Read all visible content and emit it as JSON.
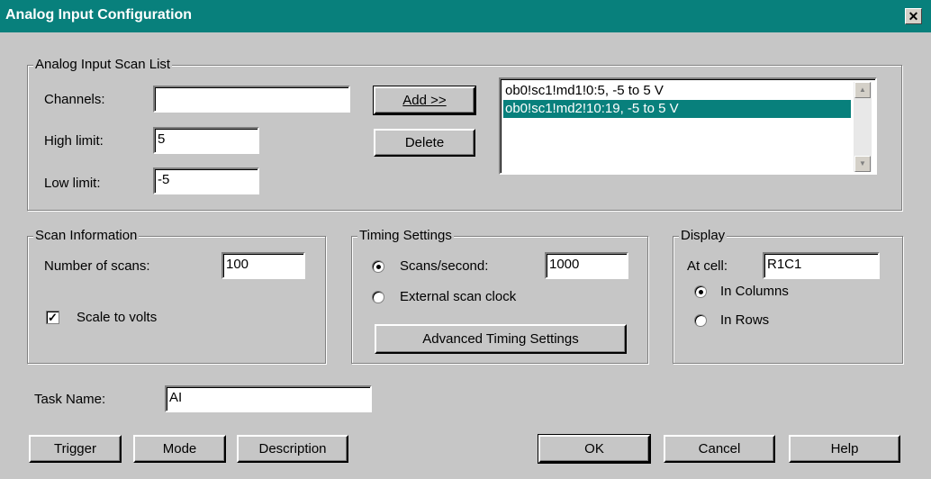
{
  "window": {
    "title": "Analog Input Configuration",
    "close_glyph": "✕"
  },
  "scan_list": {
    "group_title": "Analog Input Scan List",
    "channels_label": "Channels:",
    "channels_value": "",
    "high_label": "High limit:",
    "high_value": "5",
    "low_label": "Low limit:",
    "low_value": "-5",
    "add_label": "Add >>",
    "delete_label": "Delete",
    "items": [
      {
        "text": "ob0!sc1!md1!0:5, -5 to 5 V",
        "selected": false
      },
      {
        "text": "ob0!sc1!md2!10:19, -5 to 5 V",
        "selected": true
      }
    ]
  },
  "scan_info": {
    "group_title": "Scan Information",
    "scans_label": "Number of scans:",
    "scans_value": "100",
    "scale_label": "Scale to volts",
    "scale_checked": true
  },
  "timing": {
    "group_title": "Timing Settings",
    "scans_per_second_label": "Scans/second:",
    "scans_per_second_value": "1000",
    "external_label": "External scan clock",
    "selected": "scans_per_second",
    "advanced_label": "Advanced Timing Settings"
  },
  "display": {
    "group_title": "Display",
    "cell_label": "At cell:",
    "cell_value": "R1C1",
    "columns_label": "In Columns",
    "rows_label": "In Rows",
    "selected": "columns"
  },
  "task": {
    "label": "Task Name:",
    "value": "AI"
  },
  "buttons": {
    "trigger": "Trigger",
    "mode": "Mode",
    "description": "Description",
    "ok": "OK",
    "cancel": "Cancel",
    "help": "Help"
  }
}
